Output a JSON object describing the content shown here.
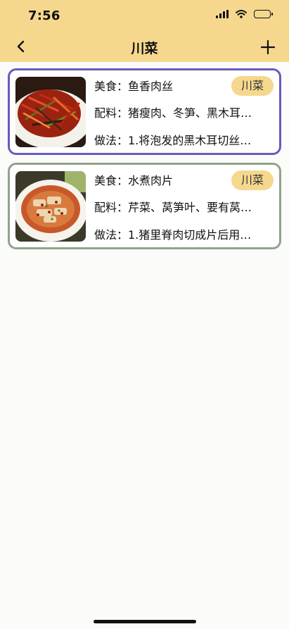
{
  "status_bar": {
    "time": "7:56"
  },
  "nav": {
    "title": "川菜",
    "back_icon": "chevron-left-icon",
    "add_icon": "plus-icon"
  },
  "colors": {
    "header": "#f5d88e",
    "tag": "#f5d88e",
    "card1_border": "#6a59bd",
    "card2_border": "#90a487"
  },
  "recipes": [
    {
      "food": "美食：鱼香肉丝",
      "ingredients": "配料：猪瘦肉、冬笋、黑木耳…",
      "method": "做法：1.将泡发的黑木耳切丝…",
      "tag": "川菜",
      "image": "shredded-pork-dish-image"
    },
    {
      "food": "美食：水煮肉片",
      "ingredients": "配料：芹菜、莴笋叶、要有莴…",
      "method": "做法：1.猪里脊肉切成片后用…",
      "tag": "川菜",
      "image": "boiled-pork-slices-dish-image"
    }
  ]
}
